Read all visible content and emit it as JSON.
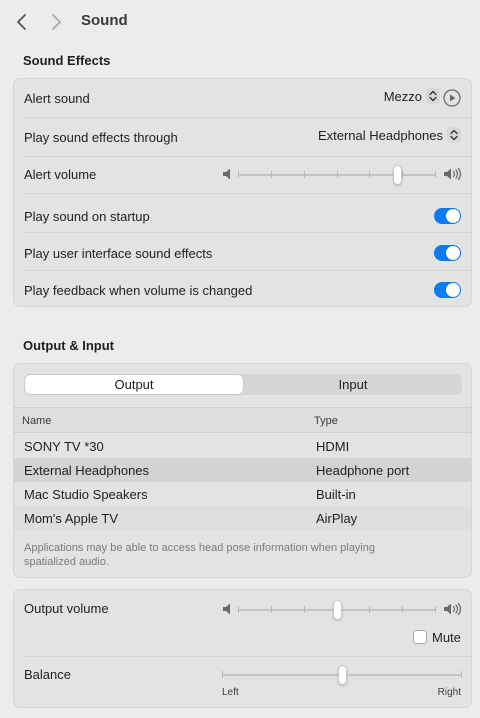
{
  "window": {
    "title": "Sound"
  },
  "sound_effects": {
    "title": "Sound Effects",
    "alert_sound": {
      "label": "Alert sound",
      "value": "Mezzo"
    },
    "play_through": {
      "label": "Play sound effects through",
      "value": "External Headphones"
    },
    "alert_volume": {
      "label": "Alert volume",
      "level": 0.82
    },
    "startup": {
      "label": "Play sound on startup",
      "on": true
    },
    "ui_effects": {
      "label": "Play user interface sound effects",
      "on": true
    },
    "feedback": {
      "label": "Play feedback when volume is changed",
      "on": true
    }
  },
  "output_input": {
    "title": "Output & Input",
    "tabs": [
      "Output",
      "Input"
    ],
    "active_tab": "Output",
    "columns": {
      "name": "Name",
      "type": "Type"
    },
    "devices": [
      {
        "name": "SONY TV  *30",
        "type": "HDMI"
      },
      {
        "name": "External Headphones",
        "type": "Headphone port",
        "selected": true
      },
      {
        "name": "Mac Studio Speakers",
        "type": "Built-in"
      },
      {
        "name": "Mom's Apple TV",
        "type": "AirPlay"
      }
    ],
    "footnote": "Applications may be able to access head pose information when playing spatialized audio."
  },
  "output": {
    "volume_label": "Output volume",
    "volume_level": 0.5,
    "mute_label": "Mute",
    "muted": false,
    "balance_label": "Balance",
    "balance_level": 0.5,
    "balance_left": "Left",
    "balance_right": "Right"
  },
  "colors": {
    "accent": "#0a7bf5",
    "background": "#ececec",
    "card": "#e3e3e3"
  },
  "icons": {
    "back": "chevron-left-icon",
    "forward": "chevron-right-icon",
    "play": "play-circle-icon",
    "stepper": "up-down-chevron-icon",
    "volume_low": "speaker-low-icon",
    "volume_high": "speaker-high-icon"
  }
}
